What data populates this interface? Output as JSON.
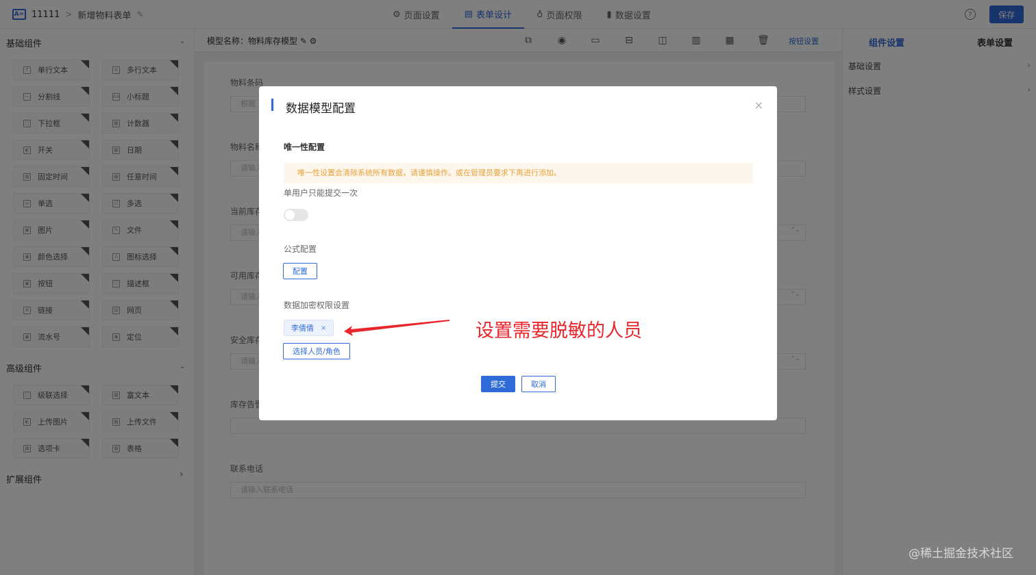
{
  "header": {
    "app_icon": "A=",
    "title": "11111",
    "separator": ">",
    "subtitle": "新增物料表单",
    "edit_icon": "pencil-icon",
    "tabs": [
      {
        "icon": "⚙",
        "label": "页面设置"
      },
      {
        "icon": "▤",
        "label": "表单设计"
      },
      {
        "icon": "♁",
        "label": "页面权限"
      },
      {
        "icon": "▮",
        "label": "数据设置"
      }
    ],
    "help": "?",
    "save_label": "保存"
  },
  "sidebar": {
    "basic_title": "基础组件",
    "basic_items": [
      "单行文本",
      "多行文本",
      "分割线",
      "小标题",
      "下拉框",
      "计数器",
      "开关",
      "日期",
      "固定时间",
      "任意时间",
      "单选",
      "多选",
      "图片",
      "文件",
      "颜色选择",
      "图标选择",
      "按钮",
      "描述框",
      "链接",
      "网页",
      "流水号",
      "定位"
    ],
    "advanced_title": "高级组件",
    "advanced_items": [
      "级联选择",
      "富文本",
      "上传图片",
      "上传文件",
      "选项卡",
      "表格"
    ],
    "extended_title": "扩展组件",
    "chevron_down": "⌄",
    "chevron_right": "›"
  },
  "toolbar": {
    "model_name": "模型名称：物料库存模型 ✎ ⚙",
    "icons": [
      "⧉",
      "◉",
      "▭",
      "⊟",
      "◫",
      "▥",
      "▦",
      "🗑"
    ],
    "button_setting": "按钮设置"
  },
  "canvas": {
    "fields": [
      {
        "label": "物料条码",
        "placeholder": "根据"
      },
      {
        "label": "物料名称",
        "placeholder": "请输入"
      },
      {
        "label": "当前库存",
        "placeholder": "请输入"
      },
      {
        "label": "可用库存",
        "placeholder": "请输入"
      },
      {
        "label": "安全库存",
        "placeholder": "请输入"
      },
      {
        "label": "库存告警",
        "placeholder": ""
      },
      {
        "label": "联系电话",
        "placeholder": "请输入联系电话"
      }
    ],
    "stepper": "⌃⌄"
  },
  "right_panel": {
    "tab_component": "组件设置",
    "tab_form": "表单设置",
    "rows": [
      "基础设置",
      "样式设置"
    ],
    "chevron": "›"
  },
  "modal": {
    "title": "数据模型配置",
    "close": "×",
    "section_unique": "唯一性配置",
    "alert_text": "唯一性设置会清除系统所有数据，请谨慎操作。或在管理员要求下再进行添加。",
    "single_submit_label": "单用户只能提交一次",
    "formula_label": "公式配置",
    "formula_button": "配置",
    "encrypt_label": "数据加密权限设置",
    "tag_person": "李倩倩",
    "tag_close": "×",
    "select_button": "选择人员/角色",
    "submit": "提交",
    "cancel": "取消"
  },
  "annotation": {
    "text": "设置需要脱敏的人员",
    "color": "#e8262c"
  },
  "watermark": "@稀土掘金技术社区",
  "colors": {
    "accent": "#2f6bd8",
    "alert_bg": "#fdf6ec",
    "alert_text": "#e6a23c"
  }
}
